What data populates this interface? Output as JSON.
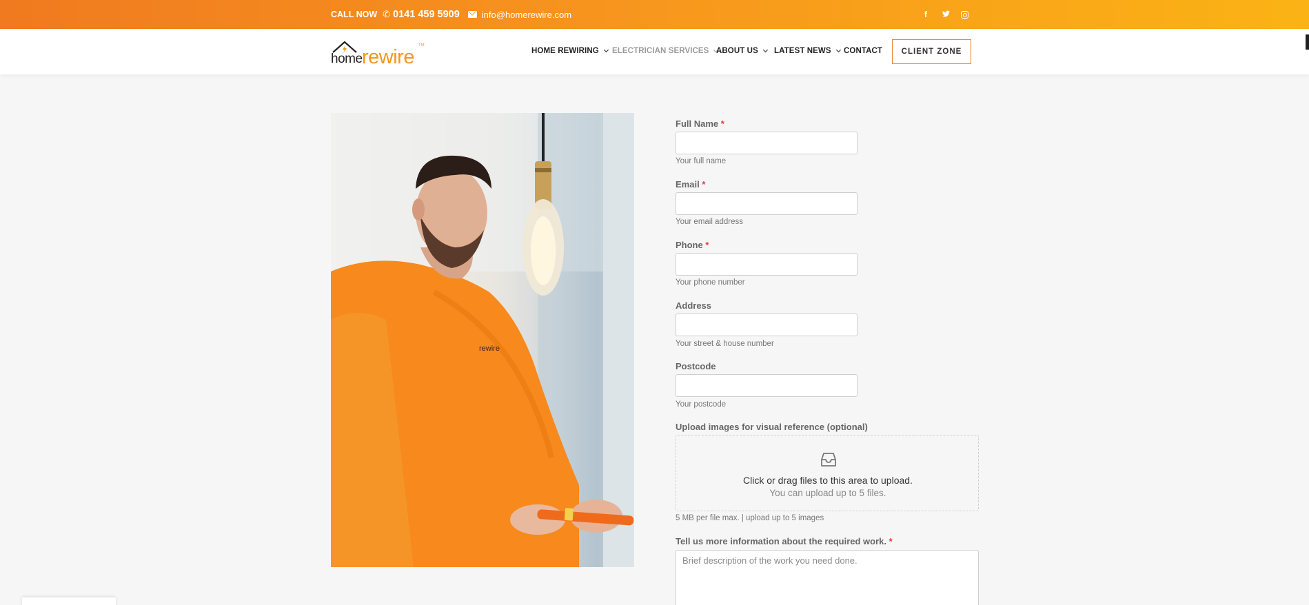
{
  "topbar": {
    "call_label": "CALL NOW",
    "phone": "0141 459 5909",
    "email": "info@homerewire.com",
    "social": {
      "facebook": "f",
      "twitter": "twitter-icon",
      "instagram": "instagram-icon"
    }
  },
  "header": {
    "logo": {
      "home": "home",
      "rewire": "rewire",
      "tm": "TM"
    },
    "nav": [
      {
        "label": "HOME REWIRING",
        "dropdown": true
      },
      {
        "label": "ELECTRICIAN SERVICES",
        "dropdown": true
      },
      {
        "label": "ABOUT US",
        "dropdown": true
      },
      {
        "label": "LATEST NEWS",
        "dropdown": true
      },
      {
        "label": "CONTACT",
        "dropdown": false
      }
    ],
    "client_zone": "CLIENT ZONE"
  },
  "form": {
    "full_name": {
      "label": "Full Name",
      "required": "*",
      "value": "",
      "help": "Your full name"
    },
    "email": {
      "label": "Email",
      "required": "*",
      "value": "",
      "help": "Your email address"
    },
    "phone": {
      "label": "Phone",
      "required": "*",
      "value": "",
      "help": "Your phone number"
    },
    "address": {
      "label": "Address",
      "value": "",
      "help": "Your street & house number"
    },
    "postcode": {
      "label": "Postcode",
      "value": "",
      "help": "Your postcode"
    },
    "upload": {
      "label": "Upload images for visual reference (optional)",
      "primary": "Click or drag files to this area to upload.",
      "secondary": "You can upload up to 5 files.",
      "help": "5 MB per file max. | upload up to 5 images"
    },
    "details": {
      "label": "Tell us more information about the required work.",
      "required": "*",
      "placeholder": "Brief description of the work you need done."
    }
  },
  "colors": {
    "accent": "#f7941e",
    "accent_dark": "#f07a1f",
    "required": "#e53935"
  }
}
